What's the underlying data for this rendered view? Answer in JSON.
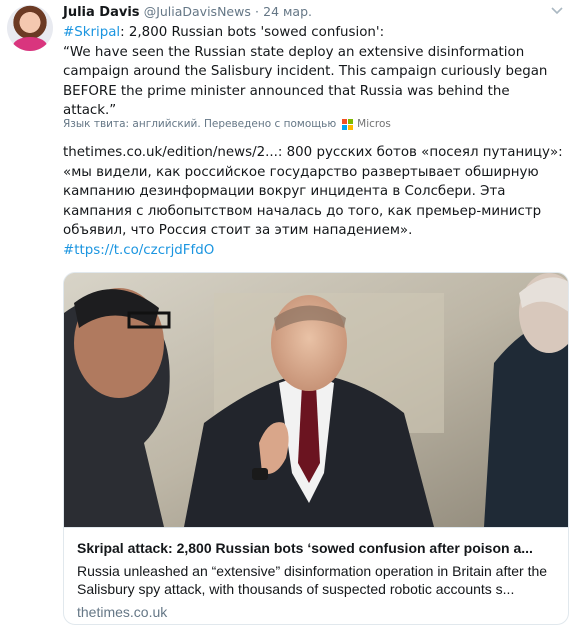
{
  "tweet": {
    "author_name": "Julia Davis",
    "author_handle": "@JuliaDavisNews",
    "separator": "·",
    "timestamp": "24 мар.",
    "hashtag": "#Skripal",
    "headline_rest": ": 2,800 Russian bots 'sowed confusion':",
    "quote": "“We have seen the Russian state deploy an extensive disinformation campaign around the Salisbury incident. This campaign curiously began BEFORE the prime minister announced that Russia was behind the attack.”",
    "translation_label": "Язык твита: английский. Переведено с помощью",
    "translation_provider": "Micros",
    "translated_text": "thetimes.co.uk/edition/news/2...: 800 русских ботов «посеял путаницу»: «мы видели, как российское государство развертывает обширную кампанию дезинформации вокруг инцидента в Солсбери. Эта кампания с любопытством началась до того, как премьер-министр объявил, что Россия стоит за этим нападением».",
    "translated_link": "#ttps://t.co/czcrjdFfdO"
  },
  "card": {
    "title": "Skripal attack: 2,800 Russian bots ‘sowed confusion after poison a...",
    "description": "Russia unleashed an “extensive” disinformation operation in Britain after the Salisbury spy attack, with thousands of suspected robotic accounts s...",
    "domain": "thetimes.co.uk"
  },
  "colors": {
    "link": "#1b95e0",
    "muted": "#657786",
    "border": "#e1e8ed",
    "ms_red": "#f25022",
    "ms_green": "#7fba00",
    "ms_blue": "#00a4ef",
    "ms_yellow": "#ffb900"
  },
  "icons": {
    "caret": "chevron-down-icon",
    "provider": "microsoft-logo-icon"
  }
}
